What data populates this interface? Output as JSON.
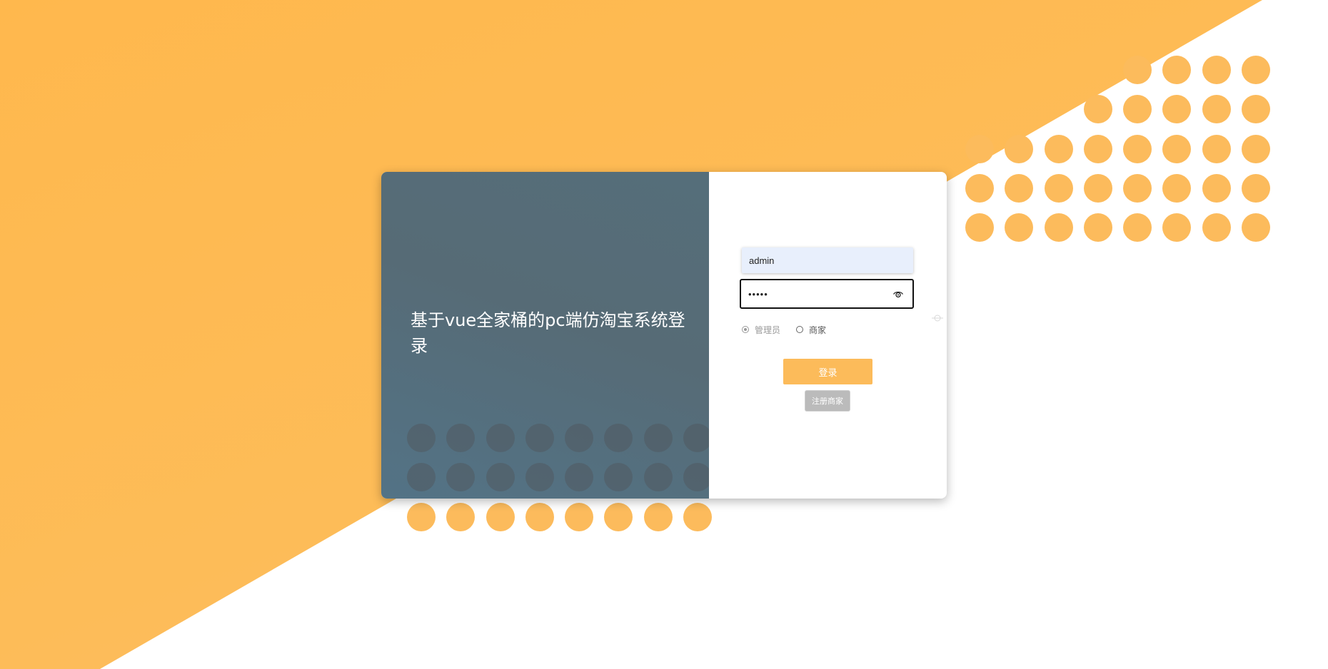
{
  "page": {
    "title": "基于vue全家桶的pc端仿淘宝系统登录"
  },
  "colors": {
    "accent": "#fcbb5a",
    "panel": "#566b76",
    "register_button": "#bbbbbb"
  },
  "login_form": {
    "username_value": "admin",
    "password_value": "•••••",
    "password_toggle_icon": "eye-icon",
    "roles": [
      {
        "label": "管理员",
        "checked": true
      },
      {
        "label": "商家",
        "checked": false
      }
    ],
    "login_label": "登录",
    "register_label": "注册商家"
  }
}
